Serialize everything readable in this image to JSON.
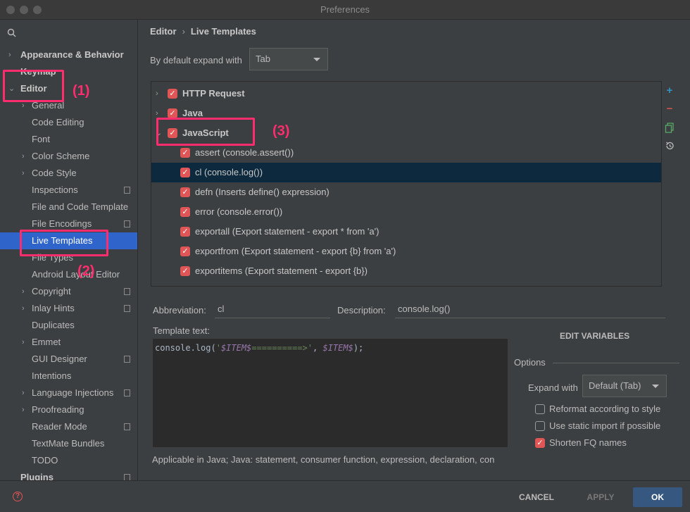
{
  "window": {
    "title": "Preferences"
  },
  "sidebar": {
    "search_icon": "search-icon",
    "items": [
      {
        "label": "Appearance & Behavior",
        "arrow": "›"
      },
      {
        "label": "Keymap"
      },
      {
        "label": "Editor",
        "arrow": "⌄"
      },
      {
        "label": "General",
        "arrow": "›"
      },
      {
        "label": "Code Editing"
      },
      {
        "label": "Font"
      },
      {
        "label": "Color Scheme",
        "arrow": "›"
      },
      {
        "label": "Code Style",
        "arrow": "›"
      },
      {
        "label": "Inspections"
      },
      {
        "label": "File and Code Template"
      },
      {
        "label": "File Encodings"
      },
      {
        "label": "Live Templates"
      },
      {
        "label": "File Types"
      },
      {
        "label": "Android Layout Editor"
      },
      {
        "label": "Copyright",
        "arrow": "›"
      },
      {
        "label": "Inlay Hints",
        "arrow": "›"
      },
      {
        "label": "Duplicates"
      },
      {
        "label": "Emmet",
        "arrow": "›"
      },
      {
        "label": "GUI Designer"
      },
      {
        "label": "Intentions"
      },
      {
        "label": "Language Injections",
        "arrow": "›"
      },
      {
        "label": "Proofreading",
        "arrow": "›"
      },
      {
        "label": "Reader Mode"
      },
      {
        "label": "TextMate Bundles"
      },
      {
        "label": "TODO"
      },
      {
        "label": "Plugins"
      }
    ]
  },
  "breadcrumb": {
    "parent": "Editor",
    "separator": "›",
    "current": "Live Templates"
  },
  "expand_default": {
    "label": "By default expand with",
    "value": "Tab"
  },
  "templates": [
    {
      "label": "HTTP Request",
      "checked": true
    },
    {
      "label": "Java",
      "checked": true
    },
    {
      "label": "JavaScript",
      "checked": true
    },
    {
      "label": "assert (console.assert())",
      "checked": true
    },
    {
      "label": "cl (console.log())",
      "checked": true
    },
    {
      "label": "defn (Inserts define() expression)",
      "checked": true
    },
    {
      "label": "error (console.error())",
      "checked": true
    },
    {
      "label": "exportall (Export statement - export * from 'a')",
      "checked": true
    },
    {
      "label": "exportfrom (Export statement - export {b} from 'a')",
      "checked": true
    },
    {
      "label": "exportitems (Export statement - export {b})",
      "checked": true
    }
  ],
  "tools": {
    "add": "+",
    "remove": "−",
    "copy_icon": "copy-icon",
    "restore_icon": "restore-icon"
  },
  "abbreviation": {
    "label": "Abbreviation:",
    "value": "cl"
  },
  "description": {
    "label": "Description:",
    "value": "console.log()"
  },
  "template_text": {
    "label": "Template text:",
    "code_prefix": "console.log(",
    "quote_open": "'",
    "var1": "$ITEM$",
    "arrow": "==========>",
    "quote_close": "'",
    "comma": ", ",
    "var2": "$ITEM$",
    "code_suffix": ");"
  },
  "edit_variables": "EDIT VARIABLES",
  "options": {
    "title": "Options",
    "expand_with_label": "Expand with",
    "expand_with_value": "Default (Tab)",
    "reformat": {
      "label": "Reformat according to style",
      "checked": false
    },
    "static_import": {
      "label": "Use static import if possible",
      "checked": false
    },
    "shorten_fq": {
      "label": "Shorten FQ names",
      "checked": true
    }
  },
  "applicable": "Applicable in Java; Java: statement, consumer function, expression, declaration, con",
  "footer": {
    "help": "?",
    "cancel": "CANCEL",
    "apply": "APPLY",
    "ok": "OK"
  },
  "annotations": [
    "(1)",
    "(2)",
    "(3)"
  ],
  "colors": {
    "accent_selected": "#2f65ca",
    "checkbox": "#e05555",
    "annotation": "#ff2d6e",
    "ok_button": "#365880"
  }
}
